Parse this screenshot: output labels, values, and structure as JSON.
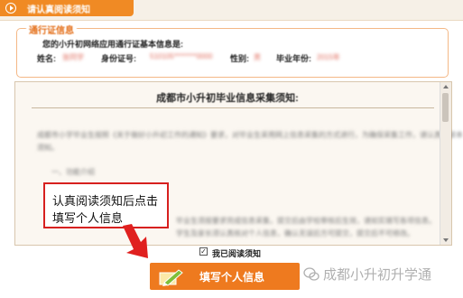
{
  "tab": {
    "label": "请认真阅读须知",
    "icon": "play-circle-icon"
  },
  "pass": {
    "legend": "通行证信息",
    "intro": "您的小升初网络应用通行证基本信息是:",
    "name_label": "姓名:",
    "name_value": "张同学",
    "id_label": "身份证号:",
    "id_value": "510105********0000",
    "gender_label": "性别:",
    "gender_value": "男",
    "year_label": "毕业年份:",
    "year_value": "2015年"
  },
  "notice": {
    "title": "成都市小升初毕业信息采集须知:",
    "paragraphs": [
      "成都市小学毕业生按照《关于做好小升初工作的通知》要求，对毕业生采用网上信息采集的方式进行，为确保采集工作，请认真阅读本",
      "须知。",
      "一、功能介绍",
      "",
      "",
      "",
      "毕业生须按要求完成信息采集，提交后由学校审核后生效，请如实填写各项信息。",
      "学生及家长须认真核对个人信息，确认无误后方可提交，提交后不可修改。"
    ]
  },
  "callout": {
    "line1": "认真阅读须知后点击",
    "line2": "填写个人信息"
  },
  "agree": {
    "checked": "✓",
    "label": "我已阅读须知"
  },
  "fill_button": {
    "label": "填写个人信息"
  },
  "watermark": {
    "text": "成都小升初升学通"
  },
  "colors": {
    "accent": "#ee7a1f",
    "callout_border": "#d7201f",
    "arrow": "#e0201f"
  }
}
